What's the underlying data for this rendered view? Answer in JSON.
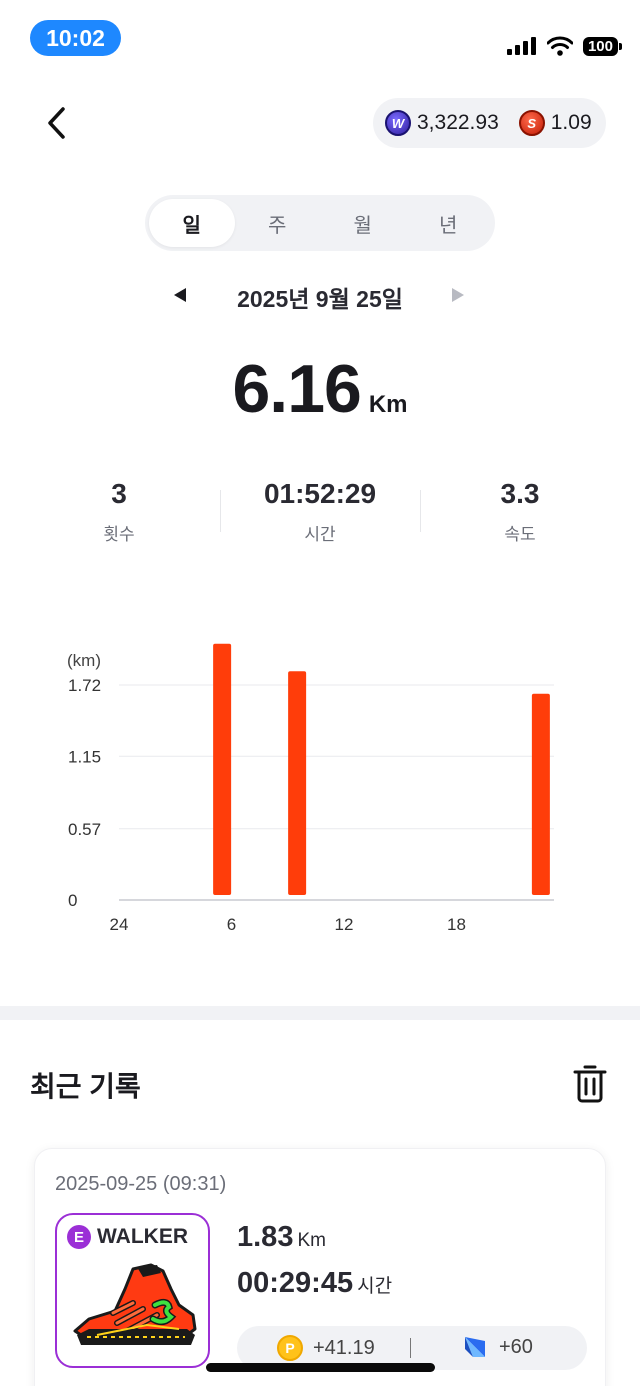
{
  "status_bar": {
    "time": "10:02",
    "battery": "100"
  },
  "balance": {
    "w_amount": "3,322.93",
    "s_amount": "1.09"
  },
  "period_tabs": [
    "일",
    "주",
    "월",
    "년"
  ],
  "date": "2025년 9월 25일",
  "distance": {
    "value": "6.16",
    "unit": "Km"
  },
  "stats": [
    {
      "value": "3",
      "label": "횟수"
    },
    {
      "value": "01:52:29",
      "label": "시간"
    },
    {
      "value": "3.3",
      "label": "속도"
    }
  ],
  "chart_data": {
    "type": "bar",
    "ylabel": "(km)",
    "y_ticks": [
      "0",
      "0.57",
      "1.15",
      "1.72"
    ],
    "x_ticks": [
      {
        "label": "24",
        "hour": 0
      },
      {
        "label": "6",
        "hour": 6
      },
      {
        "label": "12",
        "hour": 12
      },
      {
        "label": "18",
        "hour": 18
      }
    ],
    "bars": [
      {
        "hour": 5,
        "value": 2.05
      },
      {
        "hour": 9,
        "value": 1.83
      },
      {
        "hour": 22,
        "value": 1.65
      }
    ],
    "ylim": [
      0,
      2.0
    ],
    "grid": true,
    "color": "#ff3d0a"
  },
  "recent": {
    "title": "최근 기록",
    "record": {
      "datetime": "2025-09-25 (09:31)",
      "grade": "E",
      "shoe_type": "WALKER",
      "distance": "1.83",
      "distance_unit": "Km",
      "duration": "00:29:45",
      "duration_unit": "시간",
      "reward_points": "+41.19",
      "reward_gems": "+60"
    }
  },
  "colors": {
    "accent": "#ff3d0a",
    "time_pill": "#1e88ff",
    "grade_purple": "#9b2fd6"
  }
}
